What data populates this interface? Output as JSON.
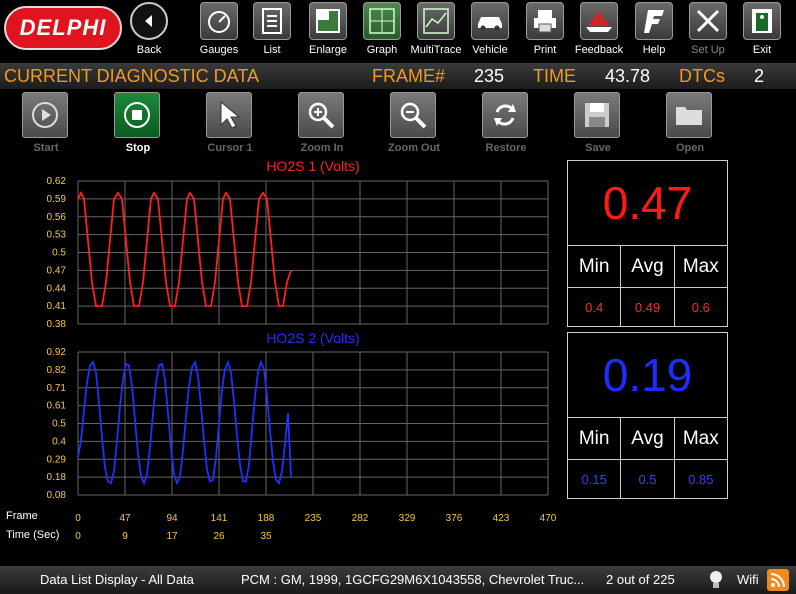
{
  "brand": {
    "logo_text": "DELPHI"
  },
  "toolbar": {
    "items": [
      {
        "label": "Back",
        "icon": "back-arrow-icon"
      },
      {
        "label": "Gauges",
        "icon": "gauge-icon"
      },
      {
        "label": "List",
        "icon": "list-icon"
      },
      {
        "label": "Enlarge",
        "icon": "enlarge-icon"
      },
      {
        "label": "Graph",
        "icon": "graph-icon"
      },
      {
        "label": "MultiTrace",
        "icon": "multitrace-icon"
      },
      {
        "label": "Vehicle",
        "icon": "car-icon"
      },
      {
        "label": "Print",
        "icon": "printer-icon"
      },
      {
        "label": "Feedback",
        "icon": "feedback-ship-icon"
      },
      {
        "label": "Help",
        "icon": "help-icon"
      },
      {
        "label": "Set Up",
        "icon": "tools-icon"
      },
      {
        "label": "Exit",
        "icon": "exit-icon"
      }
    ]
  },
  "header": {
    "title": "CURRENT DIAGNOSTIC DATA",
    "frame_label": "FRAME#",
    "frame_value": "235",
    "time_label": "TIME",
    "time_value": "43.78",
    "dtcs_label": "DTCs",
    "dtcs_value": "2"
  },
  "controls": [
    {
      "label": "Start",
      "icon": "play-icon",
      "active": false
    },
    {
      "label": "Stop",
      "icon": "stop-icon",
      "active": true
    },
    {
      "label": "Cursor 1",
      "icon": "cursor-icon",
      "active": false
    },
    {
      "label": "Zoom In",
      "icon": "zoom-in-icon",
      "active": false
    },
    {
      "label": "Zoom Out",
      "icon": "zoom-out-icon",
      "active": false
    },
    {
      "label": "Restore",
      "icon": "restore-icon",
      "active": false
    },
    {
      "label": "Save",
      "icon": "save-icon",
      "active": false
    },
    {
      "label": "Open",
      "icon": "folder-icon",
      "active": false
    }
  ],
  "colors": {
    "accent": "#f39a1e",
    "series1": "#ff2020",
    "series2": "#2030ff",
    "axis_numbers": "#f5c842"
  },
  "chart_data": [
    {
      "type": "line",
      "title": "HO2S 1 (Volts)",
      "x": [
        0,
        235
      ],
      "xlim": [
        0,
        470
      ],
      "ylim": [
        0.38,
        0.62
      ],
      "yticks": [
        "0.62",
        "0.59",
        "0.56",
        "0.53",
        "0.5",
        "0.47",
        "0.44",
        "0.41",
        "0.38"
      ],
      "series": [
        {
          "name": "HO2S 1",
          "points": [
            [
              0,
              0.59
            ],
            [
              3,
              0.6
            ],
            [
              6,
              0.59
            ],
            [
              10,
              0.52
            ],
            [
              14,
              0.45
            ],
            [
              18,
              0.41
            ],
            [
              24,
              0.41
            ],
            [
              28,
              0.45
            ],
            [
              32,
              0.52
            ],
            [
              36,
              0.59
            ],
            [
              40,
              0.6
            ],
            [
              44,
              0.59
            ],
            [
              48,
              0.52
            ],
            [
              52,
              0.45
            ],
            [
              56,
              0.41
            ],
            [
              61,
              0.41
            ],
            [
              65,
              0.45
            ],
            [
              69,
              0.52
            ],
            [
              73,
              0.59
            ],
            [
              76,
              0.6
            ],
            [
              80,
              0.59
            ],
            [
              84,
              0.52
            ],
            [
              88,
              0.45
            ],
            [
              92,
              0.41
            ],
            [
              97,
              0.41
            ],
            [
              101,
              0.45
            ],
            [
              105,
              0.52
            ],
            [
              109,
              0.59
            ],
            [
              112,
              0.6
            ],
            [
              116,
              0.59
            ],
            [
              120,
              0.52
            ],
            [
              124,
              0.45
            ],
            [
              128,
              0.41
            ],
            [
              133,
              0.41
            ],
            [
              137,
              0.45
            ],
            [
              141,
              0.52
            ],
            [
              145,
              0.59
            ],
            [
              148,
              0.6
            ],
            [
              152,
              0.59
            ],
            [
              156,
              0.52
            ],
            [
              160,
              0.45
            ],
            [
              164,
              0.41
            ],
            [
              169,
              0.41
            ],
            [
              173,
              0.45
            ],
            [
              177,
              0.52
            ],
            [
              181,
              0.59
            ],
            [
              185,
              0.6
            ],
            [
              189,
              0.59
            ],
            [
              193,
              0.52
            ],
            [
              197,
              0.45
            ],
            [
              201,
              0.41
            ],
            [
              205,
              0.41
            ],
            [
              209,
              0.45
            ],
            [
              213,
              0.47
            ]
          ]
        }
      ]
    },
    {
      "type": "line",
      "title": "HO2S 2 (Volts)",
      "x": [
        0,
        235
      ],
      "xlim": [
        0,
        470
      ],
      "ylim": [
        0.08,
        0.92
      ],
      "yticks": [
        "0.92",
        "0.82",
        "0.71",
        "0.61",
        "0.5",
        "0.4",
        "0.29",
        "0.18",
        "0.08"
      ],
      "series": [
        {
          "name": "HO2S 2",
          "points": [
            [
              0,
              0.3
            ],
            [
              3,
              0.4
            ],
            [
              6,
              0.58
            ],
            [
              9,
              0.74
            ],
            [
              12,
              0.84
            ],
            [
              15,
              0.86
            ],
            [
              18,
              0.8
            ],
            [
              21,
              0.62
            ],
            [
              24,
              0.42
            ],
            [
              27,
              0.24
            ],
            [
              30,
              0.16
            ],
            [
              33,
              0.15
            ],
            [
              36,
              0.22
            ],
            [
              39,
              0.4
            ],
            [
              42,
              0.6
            ],
            [
              45,
              0.76
            ],
            [
              48,
              0.85
            ],
            [
              51,
              0.84
            ],
            [
              54,
              0.72
            ],
            [
              57,
              0.52
            ],
            [
              60,
              0.32
            ],
            [
              63,
              0.19
            ],
            [
              66,
              0.15
            ],
            [
              69,
              0.2
            ],
            [
              72,
              0.36
            ],
            [
              75,
              0.56
            ],
            [
              78,
              0.74
            ],
            [
              81,
              0.84
            ],
            [
              84,
              0.85
            ],
            [
              87,
              0.76
            ],
            [
              90,
              0.56
            ],
            [
              93,
              0.36
            ],
            [
              96,
              0.2
            ],
            [
              99,
              0.15
            ],
            [
              102,
              0.19
            ],
            [
              105,
              0.34
            ],
            [
              108,
              0.54
            ],
            [
              111,
              0.72
            ],
            [
              114,
              0.83
            ],
            [
              117,
              0.86
            ],
            [
              120,
              0.78
            ],
            [
              123,
              0.6
            ],
            [
              126,
              0.4
            ],
            [
              129,
              0.23
            ],
            [
              132,
              0.16
            ],
            [
              135,
              0.17
            ],
            [
              138,
              0.3
            ],
            [
              141,
              0.5
            ],
            [
              144,
              0.7
            ],
            [
              147,
              0.82
            ],
            [
              150,
              0.86
            ],
            [
              153,
              0.8
            ],
            [
              156,
              0.63
            ],
            [
              159,
              0.43
            ],
            [
              162,
              0.26
            ],
            [
              165,
              0.16
            ],
            [
              168,
              0.16
            ],
            [
              171,
              0.26
            ],
            [
              174,
              0.46
            ],
            [
              177,
              0.66
            ],
            [
              180,
              0.8
            ],
            [
              183,
              0.86
            ],
            [
              186,
              0.82
            ],
            [
              189,
              0.66
            ],
            [
              192,
              0.46
            ],
            [
              195,
              0.28
            ],
            [
              198,
              0.17
            ],
            [
              201,
              0.15
            ],
            [
              204,
              0.22
            ],
            [
              207,
              0.38
            ],
            [
              210,
              0.56
            ],
            [
              213,
              0.19
            ]
          ]
        }
      ]
    }
  ],
  "panel1": {
    "value": "0.47",
    "min_label": "Min",
    "avg_label": "Avg",
    "max_label": "Max",
    "min": "0.4",
    "avg": "0.49",
    "max": "0.6"
  },
  "panel2": {
    "value": "0.19",
    "min_label": "Min",
    "avg_label": "Avg",
    "max_label": "Max",
    "min": "0.15",
    "avg": "0.5",
    "max": "0.85"
  },
  "axis": {
    "frame_label": "Frame",
    "time_label": "Time (Sec)",
    "frame_ticks": [
      "0",
      "47",
      "94",
      "141",
      "188",
      "235",
      "282",
      "329",
      "376",
      "423",
      "470"
    ],
    "time_ticks": [
      "0",
      "9",
      "17",
      "26",
      "35"
    ]
  },
  "status": {
    "display": "Data List Display - All Data",
    "vehicle": "PCM :  GM,  1999,  1GCFG29M6X1043558,  Chevrolet  Truc...",
    "page": "2 out of  225",
    "wifi": "Wifi"
  }
}
